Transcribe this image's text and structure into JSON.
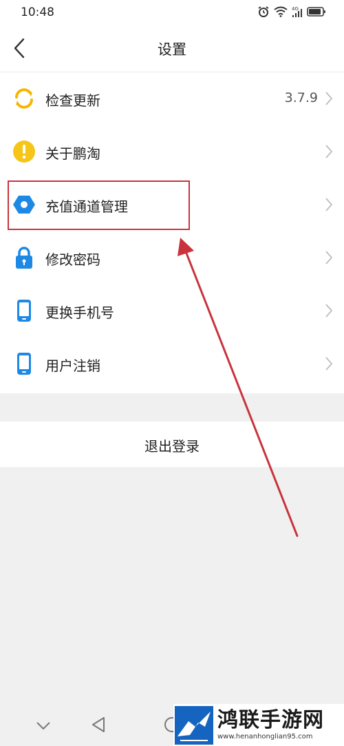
{
  "status_bar": {
    "time": "10:48",
    "icons": [
      "alarm-icon",
      "wifi-icon",
      "signal-4g-icon",
      "battery-icon"
    ]
  },
  "nav": {
    "title": "设置",
    "back_icon": "chevron-left-icon"
  },
  "settings": {
    "items": [
      {
        "label": "检查更新",
        "value": "3.7.9",
        "icon": "refresh-icon",
        "icon_color": "#f5b800"
      },
      {
        "label": "关于鹏淘",
        "value": "",
        "icon": "info-exclamation-icon",
        "icon_color": "#f5c518"
      },
      {
        "label": "充值通道管理",
        "value": "",
        "icon": "hexagon-icon",
        "icon_color": "#1e88e5"
      },
      {
        "label": "修改密码",
        "value": "",
        "icon": "lock-icon",
        "icon_color": "#1e88e5"
      },
      {
        "label": "更换手机号",
        "value": "",
        "icon": "phone-icon",
        "icon_color": "#1e88e5"
      },
      {
        "label": "用户注销",
        "value": "",
        "icon": "phone-icon",
        "icon_color": "#1e88e5"
      }
    ]
  },
  "logout": {
    "label": "退出登录"
  },
  "annotation": {
    "color": "#c8333c"
  },
  "system_nav": {
    "icons": [
      "chevron-down-icon",
      "back-triangle-icon",
      "home-circle-icon"
    ]
  },
  "watermark": {
    "title": "鸿联手游网",
    "url": "www.henanhonglian95.com"
  }
}
